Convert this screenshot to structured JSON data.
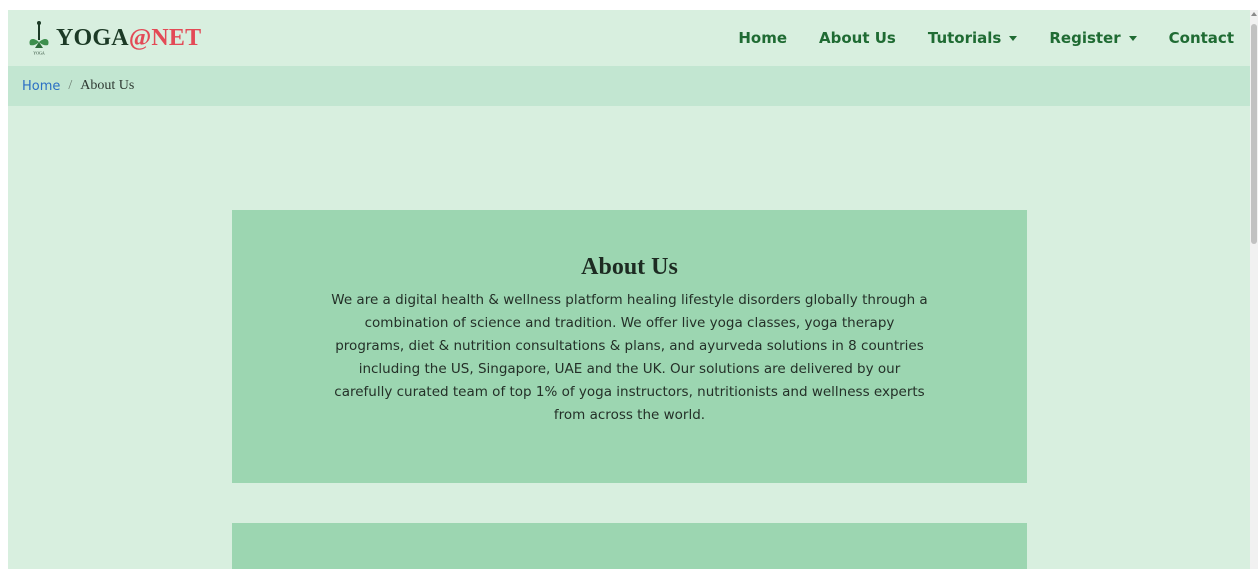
{
  "brand": {
    "name_main": "YOGA",
    "name_at": "@",
    "name_net": "NET",
    "logo_caption": "YOGA",
    "logo_icon": "yoga-figure-icon"
  },
  "nav": {
    "items": [
      {
        "label": "Home",
        "dropdown": false
      },
      {
        "label": "About Us",
        "dropdown": false
      },
      {
        "label": "Tutorials",
        "dropdown": true
      },
      {
        "label": "Register",
        "dropdown": true
      },
      {
        "label": "Contact",
        "dropdown": false
      }
    ]
  },
  "breadcrumb": {
    "home": "Home",
    "separator": "/",
    "current": "About Us"
  },
  "about": {
    "title": "About Us",
    "text": "We are a digital health & wellness platform healing lifestyle disorders globally through a combination of science and tradition. We offer live yoga classes, yoga therapy programs, diet & nutrition consultations & plans, and ayurveda solutions in 8 countries including the US, Singapore, UAE and the UK. Our solutions are delivered by our carefully curated team of top 1% of yoga instructors, nutritionists and wellness experts from across the world."
  },
  "colors": {
    "background": "#d8efdf",
    "breadcrumb_bg": "#c2e6d1",
    "card_bg": "#9cd6b1",
    "nav_text": "#1f6b33",
    "brand_accent": "#e34a56",
    "link": "#2a6fc4"
  }
}
